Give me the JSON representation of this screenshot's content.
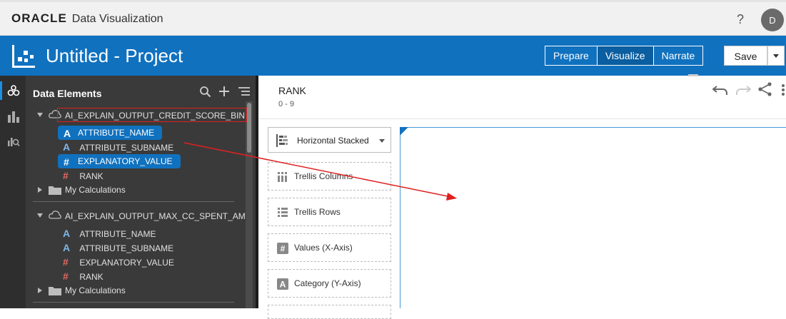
{
  "app": {
    "logo": "ORACLE",
    "name": "Data Visualization",
    "help": "?",
    "avatar_initial": "D"
  },
  "project": {
    "title": "Untitled - Project"
  },
  "modes": {
    "prepare": "Prepare",
    "visualize": "Visualize",
    "narrate": "Narrate",
    "active": "Visualize"
  },
  "toolbar": {
    "save_label": "Save"
  },
  "panel": {
    "title": "Data Elements",
    "sources": [
      {
        "name": "AI_EXPLAIN_OUTPUT_CREDIT_SCORE_BIN",
        "items": [
          {
            "type": "attribute",
            "label": "ATTRIBUTE_NAME",
            "selected": true
          },
          {
            "type": "attribute",
            "label": "ATTRIBUTE_SUBNAME",
            "selected": false
          },
          {
            "type": "measure",
            "label": "EXPLANATORY_VALUE",
            "selected": true
          },
          {
            "type": "measure",
            "label": "RANK",
            "selected": false
          }
        ],
        "folder": "My Calculations"
      },
      {
        "name": "AI_EXPLAIN_OUTPUT_MAX_CC_SPENT_AM",
        "items": [
          {
            "type": "attribute",
            "label": "ATTRIBUTE_NAME",
            "selected": false
          },
          {
            "type": "attribute",
            "label": "ATTRIBUTE_SUBNAME",
            "selected": false
          },
          {
            "type": "measure",
            "label": "EXPLANATORY_VALUE",
            "selected": false
          },
          {
            "type": "measure",
            "label": "RANK",
            "selected": false
          }
        ],
        "folder": "My Calculations"
      }
    ]
  },
  "viz": {
    "title": "RANK",
    "subtitle": "0 - 9",
    "chart_type": "Horizontal Stacked",
    "drop_zones": [
      "Trellis Columns",
      "Trellis Rows",
      "Values (X-Axis)",
      "Category (Y-Axis)"
    ]
  },
  "colors": {
    "brand_blue": "#1071bf",
    "panel_bg": "#3a3a3a",
    "annotation_red": "#e02020"
  }
}
